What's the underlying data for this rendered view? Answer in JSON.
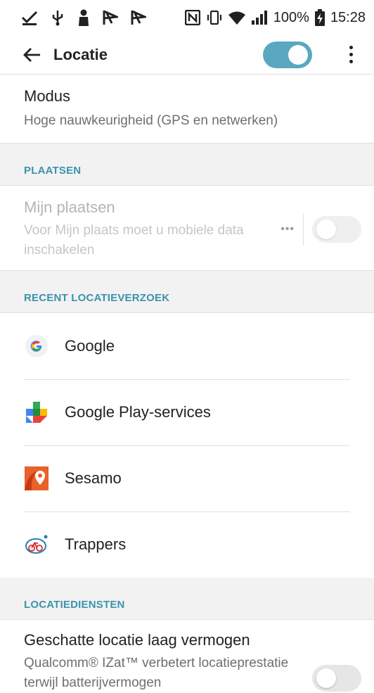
{
  "status_bar": {
    "battery_percent": "100%",
    "time": "15:28"
  },
  "toolbar": {
    "title": "Locatie",
    "toggle_on": true
  },
  "mode": {
    "title": "Modus",
    "subtitle": "Hoge nauwkeurigheid (GPS en netwerken)"
  },
  "sections": {
    "places": "PLAATSEN",
    "recent": "RECENT LOCATIEVERZOEK",
    "services": "LOCATIEDIENSTEN"
  },
  "my_places": {
    "title": "Mijn plaatsen",
    "subtitle": "Voor Mijn plaats moet u mobiele data inschakelen",
    "more": "•••"
  },
  "recent_apps": [
    {
      "name": "Google",
      "icon": "google-icon"
    },
    {
      "name": "Google Play-services",
      "icon": "play-services-icon"
    },
    {
      "name": "Sesamo",
      "icon": "sesamo-icon"
    },
    {
      "name": "Trappers",
      "icon": "trappers-icon"
    }
  ],
  "low_power": {
    "title": "Geschatte locatie laag vermogen",
    "subtitle": "Qualcomm® IZat™ verbetert locatieprestatie terwijl batterijvermogen"
  },
  "colors": {
    "accent": "#3a93ac",
    "toggle_on": "#5aa8c0"
  }
}
